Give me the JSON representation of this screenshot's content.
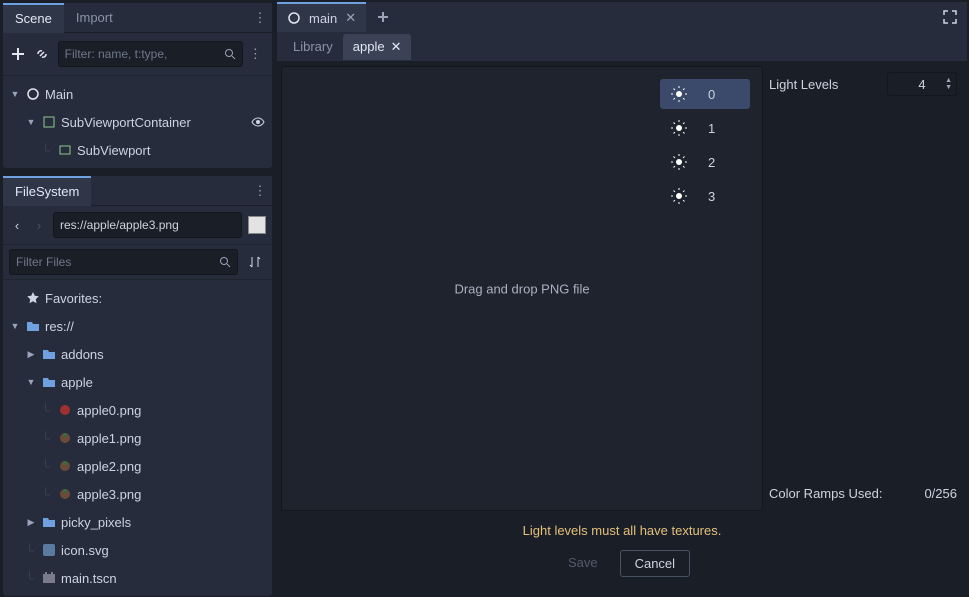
{
  "scene_dock": {
    "tabs": [
      "Scene",
      "Import"
    ],
    "filter_placeholder": "Filter: name, t:type,",
    "tree": [
      {
        "icon": "node2d",
        "label": "Main",
        "indent": 0,
        "chev": "down",
        "selected": false
      },
      {
        "icon": "container",
        "label": "SubViewportContainer",
        "indent": 1,
        "chev": "down",
        "eye": true
      },
      {
        "icon": "viewport",
        "label": "SubViewport",
        "indent": 2,
        "chev": "",
        "line": true
      }
    ]
  },
  "fs_dock": {
    "tab": "FileSystem",
    "path": "res://apple/apple3.png",
    "filter_placeholder": "Filter Files",
    "tree": [
      {
        "icon": "star",
        "label": "Favorites:",
        "indent": 0,
        "chev": ""
      },
      {
        "icon": "folder",
        "label": "res://",
        "indent": 0,
        "chev": "down"
      },
      {
        "icon": "folder",
        "label": "addons",
        "indent": 1,
        "chev": "right"
      },
      {
        "icon": "folder",
        "label": "apple",
        "indent": 1,
        "chev": "down"
      },
      {
        "icon": "png-red",
        "label": "apple0.png",
        "indent": 2,
        "chev": "",
        "line": true
      },
      {
        "icon": "png",
        "label": "apple1.png",
        "indent": 2,
        "chev": "",
        "line": true
      },
      {
        "icon": "png",
        "label": "apple2.png",
        "indent": 2,
        "chev": "",
        "line": true
      },
      {
        "icon": "png",
        "label": "apple3.png",
        "indent": 2,
        "chev": "",
        "line": true
      },
      {
        "icon": "folder",
        "label": "picky_pixels",
        "indent": 1,
        "chev": "right"
      },
      {
        "icon": "svg",
        "label": "icon.svg",
        "indent": 1,
        "chev": "",
        "line": true
      },
      {
        "icon": "tscn",
        "label": "main.tscn",
        "indent": 1,
        "chev": "",
        "line": true
      }
    ]
  },
  "main": {
    "tab_label": "main",
    "sub_tabs": {
      "library": "Library",
      "apple": "apple"
    },
    "drop_msg": "Drag and drop PNG file",
    "light_levels": [
      "0",
      "1",
      "2",
      "3"
    ],
    "selected_light": 0,
    "props": {
      "light_levels_label": "Light Levels",
      "light_levels_value": "4",
      "ramps_label": "Color Ramps Used:",
      "ramps_value": "0/256"
    },
    "warning": "Light levels must all have textures.",
    "buttons": {
      "save": "Save",
      "cancel": "Cancel"
    }
  }
}
